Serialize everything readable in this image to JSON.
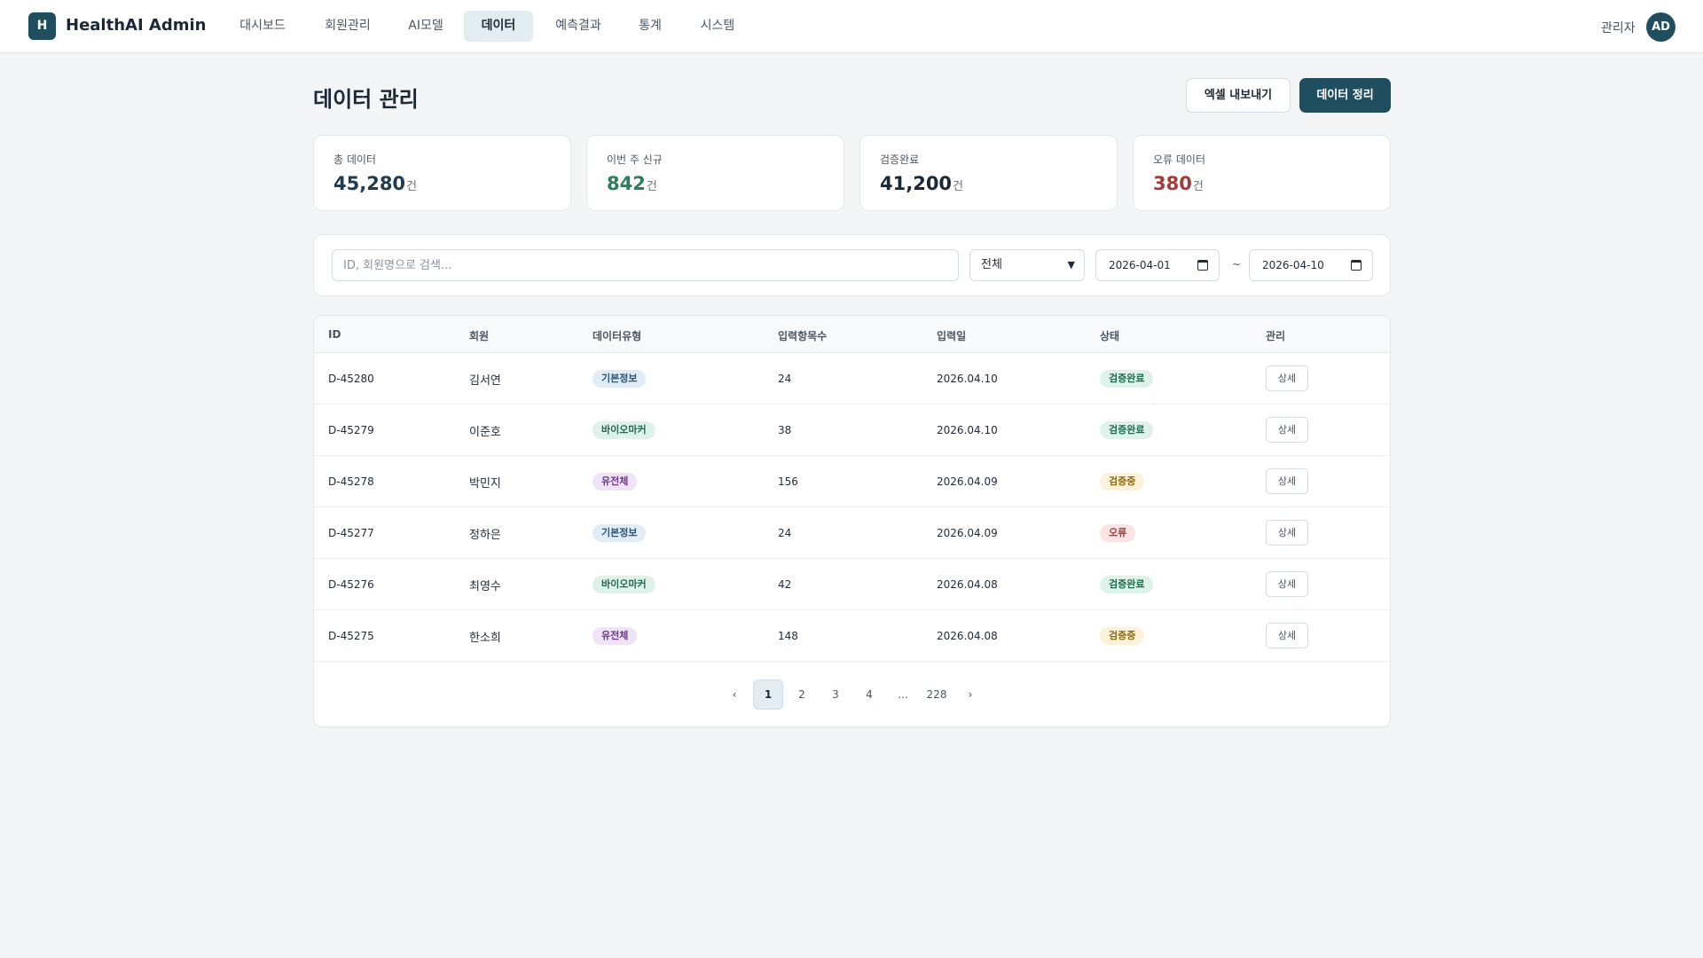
{
  "app": {
    "logo_letter": "H",
    "name": "HealthAI Admin"
  },
  "nav": {
    "items": [
      {
        "label": "대시보드"
      },
      {
        "label": "회원관리"
      },
      {
        "label": "AI모델"
      },
      {
        "label": "데이터",
        "active": true
      },
      {
        "label": "예측결과"
      },
      {
        "label": "통계"
      },
      {
        "label": "시스템"
      }
    ],
    "user_label": "관리자",
    "avatar_initials": "AD"
  },
  "page": {
    "title": "데이터 관리",
    "export_button": "엑셀 내보내기",
    "cleanup_button": "데이터 정리"
  },
  "stats": [
    {
      "label": "총 데이터",
      "value": "45,280",
      "unit": "건",
      "color": "#1f3b4d"
    },
    {
      "label": "이번 주 신규",
      "value": "842",
      "unit": "건",
      "color": "#2e7d5b"
    },
    {
      "label": "검증완료",
      "value": "41,200",
      "unit": "건",
      "color": "#1b2838"
    },
    {
      "label": "오류 데이터",
      "value": "380",
      "unit": "건",
      "color": "#a33b3b"
    }
  ],
  "filters": {
    "search_placeholder": "ID, 회원명으로 검색...",
    "type_select": "전체",
    "date_from": "2026-04-01",
    "tilde": "~",
    "date_to": "2026-04-10"
  },
  "table": {
    "columns": [
      "ID",
      "회원",
      "데이터유형",
      "입력항목수",
      "입력일",
      "상태",
      "관리"
    ],
    "rows": [
      {
        "id": "D-45280",
        "member": "김서연",
        "type": "기본정보",
        "count": "24",
        "date": "2026.04.10",
        "status": "검증완료",
        "action": "상세"
      },
      {
        "id": "D-45279",
        "member": "이준호",
        "type": "바이오마커",
        "count": "38",
        "date": "2026.04.10",
        "status": "검증완료",
        "action": "상세"
      },
      {
        "id": "D-45278",
        "member": "박민지",
        "type": "유전체",
        "count": "156",
        "date": "2026.04.09",
        "status": "검증중",
        "action": "상세"
      },
      {
        "id": "D-45277",
        "member": "정하은",
        "type": "기본정보",
        "count": "24",
        "date": "2026.04.09",
        "status": "오류",
        "action": "상세"
      },
      {
        "id": "D-45276",
        "member": "최영수",
        "type": "바이오마커",
        "count": "42",
        "date": "2026.04.08",
        "status": "검증완료",
        "action": "상세"
      },
      {
        "id": "D-45275",
        "member": "한소희",
        "type": "유전체",
        "count": "148",
        "date": "2026.04.08",
        "status": "검증중",
        "action": "상세"
      }
    ],
    "type_colors": {
      "기본정보": {
        "bg": "#e0ecf6",
        "fg": "#2c5475"
      },
      "바이오마커": {
        "bg": "#dff2ea",
        "fg": "#1f6b4d"
      },
      "유전체": {
        "bg": "#efe3f6",
        "fg": "#6b3a8a"
      }
    },
    "status_colors": {
      "검증완료": {
        "bg": "#dff2ea",
        "fg": "#1f6b4d"
      },
      "검증중": {
        "bg": "#fbf2d9",
        "fg": "#8a6a14"
      },
      "오류": {
        "bg": "#fbe3e3",
        "fg": "#a33b3b"
      }
    }
  },
  "pagination": {
    "prev": "‹",
    "pages": [
      "1",
      "2",
      "3",
      "4",
      "...",
      "228"
    ],
    "current": "1",
    "next": "›"
  }
}
